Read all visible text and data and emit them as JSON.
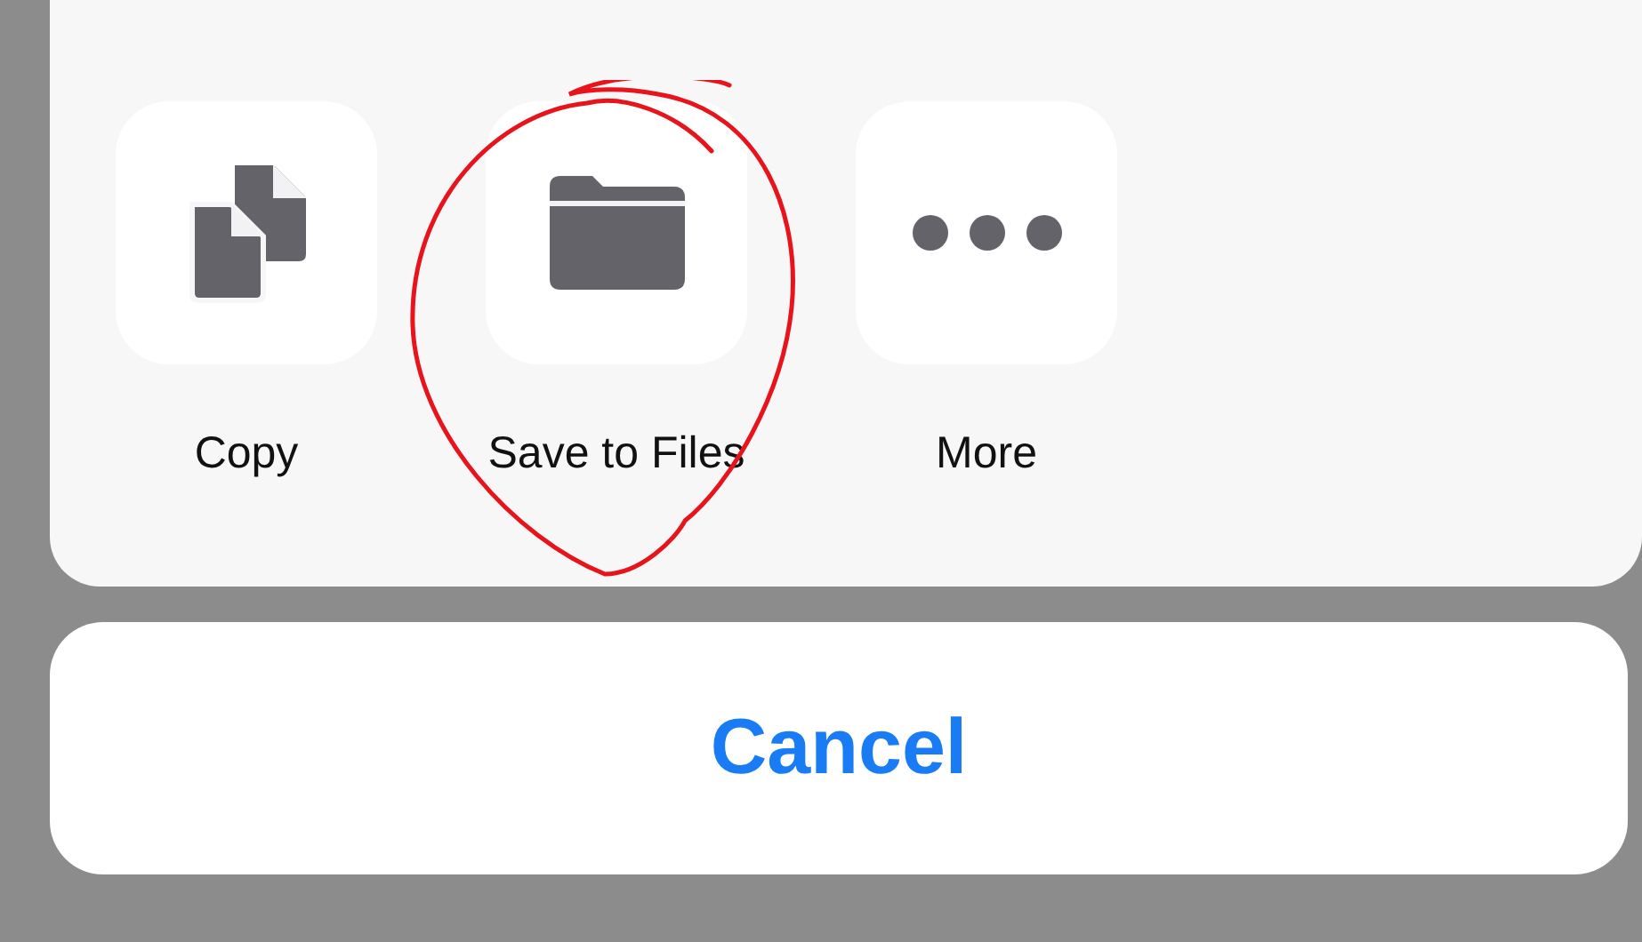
{
  "actions": [
    {
      "label": "Copy",
      "kind": "copy"
    },
    {
      "label": "Save to Files",
      "kind": "folder"
    },
    {
      "label": "More",
      "kind": "more"
    }
  ],
  "cancel_button": {
    "label": "Cancel"
  }
}
